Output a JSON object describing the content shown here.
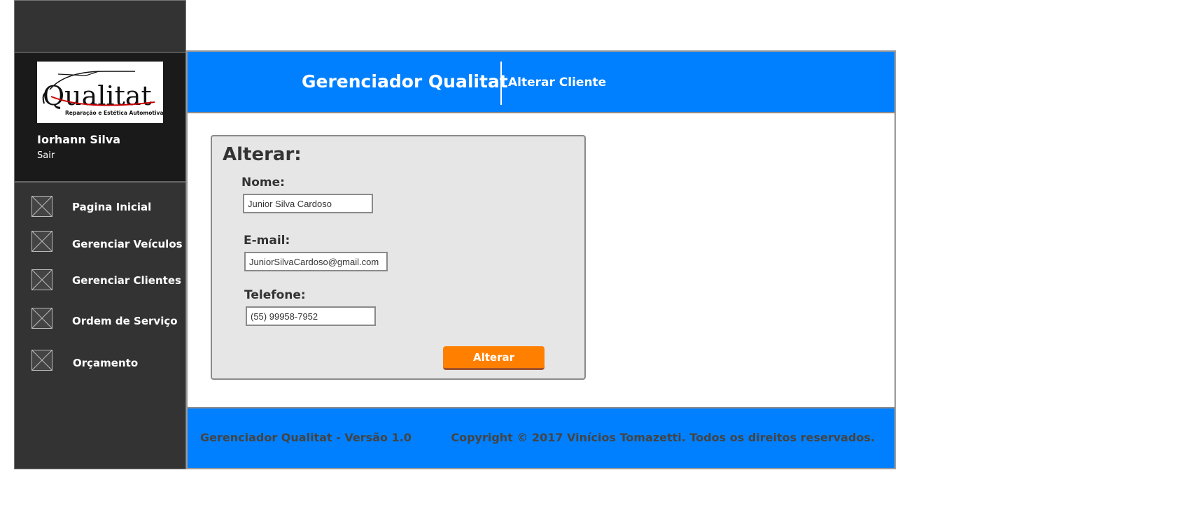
{
  "sidebar": {
    "logo_text": "Qualitat",
    "logo_tagline": "Reparação e Estética Automotiva",
    "user_name": "Iorhann Silva",
    "logout_label": "Sair",
    "items": [
      {
        "label": "Pagina Inicial",
        "icon": "image-placeholder-icon"
      },
      {
        "label": "Gerenciar Veículos",
        "icon": "image-placeholder-icon"
      },
      {
        "label": "Gerenciar Clientes",
        "icon": "image-placeholder-icon"
      },
      {
        "label": "Ordem de Serviço",
        "icon": "image-placeholder-icon"
      },
      {
        "label": "Orçamento",
        "icon": "image-placeholder-icon"
      }
    ]
  },
  "header": {
    "title": "Gerenciador Qualitat",
    "subtitle": "Alterar Cliente"
  },
  "form": {
    "title": "Alterar:",
    "name_label": "Nome:",
    "name_value": "Junior Silva Cardoso",
    "email_label": "E-mail:",
    "email_value": "JuniorSilvaCardoso@gmail.com",
    "phone_label": "Telefone:",
    "phone_value": "(55) 99958-7952",
    "submit_label": "Alterar"
  },
  "footer": {
    "version": "Gerenciador Qualitat - Versão 1.0",
    "copyright": "Copyright © 2017 Vinícios Tomazetti. Todos os direitos reservados."
  },
  "colors": {
    "header_blue": "#0080ff",
    "sidebar_dark": "#333333",
    "button_orange": "#ff8000"
  }
}
